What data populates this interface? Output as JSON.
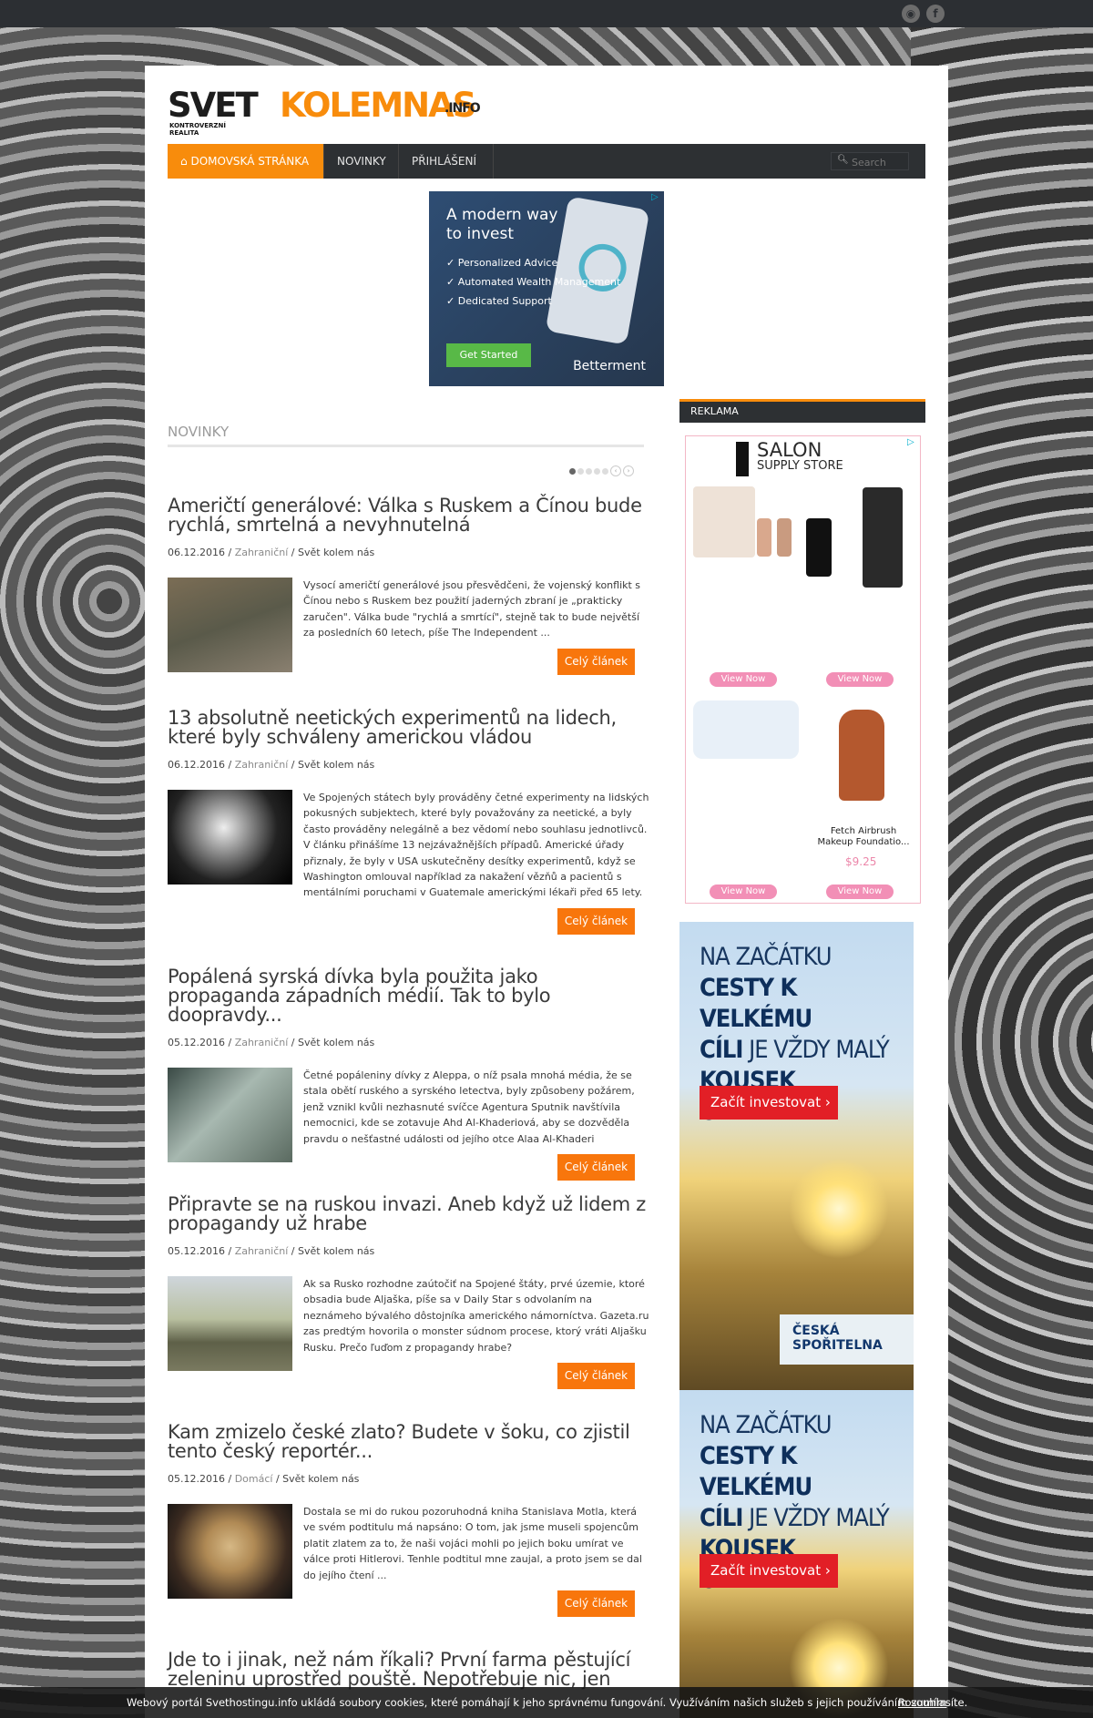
{
  "site": {
    "logo_part1": "SVET",
    "logo_part2": "KOLEMNAS",
    "logo_part3": ".INFO",
    "logo_tagline_1": "KONTROVERZNÍ",
    "logo_tagline_2": "REALITA"
  },
  "nav": {
    "items": [
      {
        "label": "DOMOVSKÁ STRÁNKA"
      },
      {
        "label": "NOVINKY"
      },
      {
        "label": "PŘIHLÁŠENÍ"
      }
    ],
    "search_placeholder": "Search"
  },
  "ad_top": {
    "headline": "A modern way to invest",
    "bullets": [
      "Personalized Advice",
      "Automated Wealth Management",
      "Dedicated Support"
    ],
    "cta": "Get Started",
    "brand": "Betterment"
  },
  "main": {
    "section_title": "NOVINKY",
    "read_more_label": "Celý článek",
    "articles": [
      {
        "title": "Američtí generálové: Válka s Ruskem a Čínou bude rychlá, smrtelná a nevyhnutelná",
        "date": "06.12.2016",
        "category": "Zahraniční",
        "tag": "Svět kolem nás",
        "excerpt": "Vysocí američtí generálové jsou přesvědčeni, že vojenský konflikt s Čínou nebo s Ruskem bez použití jaderných zbraní je „prakticky zaručen\". Válka bude \"rychlá a smrtící\", stejně tak to bude největší za posledních 60 letech, píše The Independent ..."
      },
      {
        "title": "13 absolutně neetických experimentů na lidech, které byly schváleny americkou vládou",
        "date": "06.12.2016",
        "category": "Zahraniční",
        "tag": "Svět kolem nás",
        "excerpt": "Ve Spojených státech byly prováděny četné experimenty na lidských pokusných subjektech, které byly považovány za neetické, a byly často prováděny nelegálně a bez vědomí nebo souhlasu jednotlivců. V článku přinášíme 13 nejzávažnějších případů. Americké úřady přiznaly, že byly v USA uskutečněny desítky experimentů, když se Washington omlouval například za nakažení vězňů a pacientů s mentálními poruchami v Guatemale americkými lékaři před 65 lety."
      },
      {
        "title": "Popálená syrská dívka byla použita jako propaganda západních médií. Tak to bylo doopravdy...",
        "date": "05.12.2016",
        "category": "Zahraniční",
        "tag": "Svět kolem nás",
        "excerpt": "Četné popáleniny dívky z Aleppa, o níž psala mnohá média, že se stala obětí ruského a syrského letectva, byly způsobeny požárem, jenž vznikl kvůli nezhasnuté svíčce Agentura Sputnik navštívila nemocnici, kde se zotavuje Ahd Al-Khaderiová, aby se dozvěděla pravdu o nešťastné události od jejího otce Alaa Al-Khaderi"
      },
      {
        "title": "Připravte se na ruskou invazi. Aneb když už lidem z propagandy už hrabe",
        "date": "05.12.2016",
        "category": "Zahraniční",
        "tag": "Svět kolem nás",
        "excerpt": "Ak sa Rusko rozhodne zaútočiť na Spojené štáty, prvé územie, ktoré obsadia bude Aljaška, píše sa v Daily Star s odvolaním na neznámeho bývalého dôstojníka amerického námorníctva. Gazeta.ru zas predtým hovorila o monster súdnom procese, ktorý vráti Aljašku Rusku. Prečo ľuďom z propagandy hrabe?"
      },
      {
        "title": "Kam zmizelo české zlato? Budete v šoku, co zjistil tento český reportér...",
        "date": "05.12.2016",
        "category": "Domácí",
        "tag": "Svět kolem nás",
        "excerpt": "Dostala se mi do rukou pozoruhodná kniha Stanislava Motla, která ve svém podtitulu má napsáno: O tom, jak jsme museli spojencům platit zlatem za to, že naši vojáci mohli po jejich boku umírat ve válce proti Hitlerovi. Tenhle podtitul mne zaujal, a proto jsem se dal do jejího čtení ..."
      },
      {
        "title": "Jde to i jinak, než nám říkali? První farma pěstující zeleninu uprostřed pouště. Nepotřebuje nic, jen"
      }
    ]
  },
  "sidebar": {
    "heading": "REKLAMA",
    "salon_ad": {
      "title_main": "SALON",
      "title_sub": "SUPPLY STORE",
      "view_label": "View Now",
      "product_name": "Fetch Airbrush Makeup Foundatio...",
      "product_price": "$9.25"
    },
    "bank_ad": {
      "line1": "NA ZAČÁTKU",
      "line2": "CESTY K VELKÉMU",
      "line3a": "CÍLI",
      "line3b": " JE VŽDY MALÝ",
      "line4": "KOUSEK ODVAHY",
      "cta": "Začít investovat ›",
      "brand_1": "ČESKÁ",
      "brand_2": "SPOŘITELNA"
    }
  },
  "cookie_bar": {
    "text": "Webový portál Svethostingu.info ukládá soubory cookies, které pomáhají k jeho správnému fungování. Využíváním našich služeb s jejich používáním souhlasíte.",
    "accept": "Rozumím"
  },
  "colors": {
    "accent": "#f88c0c",
    "button": "#f8760c",
    "nav_bg": "#2d3033"
  }
}
